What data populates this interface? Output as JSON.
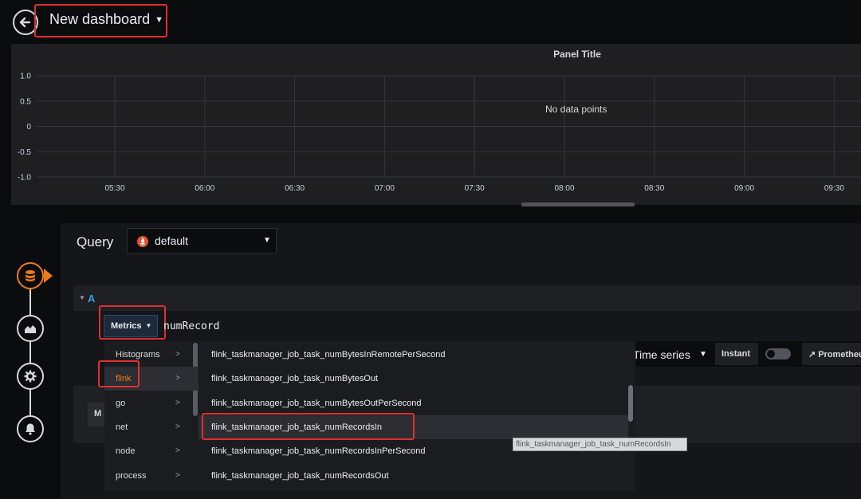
{
  "header": {
    "title": "New dashboard"
  },
  "panel": {
    "title": "Panel Title",
    "no_data": "No data points",
    "y_ticks": [
      "1.0",
      "0.5",
      "0",
      "-0.5",
      "-1.0"
    ],
    "x_ticks": [
      "05:30",
      "06:00",
      "06:30",
      "07:00",
      "07:30",
      "08:00",
      "08:30",
      "09:00",
      "09:30"
    ]
  },
  "query": {
    "label": "Query",
    "datasource": "default",
    "row_label": "A",
    "metrics_label": "Metrics",
    "input_value": "numRecord",
    "format": "Time series",
    "instant_label": "Instant",
    "prometheus_label": "Prometheu",
    "lower_box_label": "M"
  },
  "menu": {
    "categories": [
      {
        "label": "Histograms",
        "arrow": ">"
      },
      {
        "label": "flink",
        "arrow": ">"
      },
      {
        "label": "go",
        "arrow": ">"
      },
      {
        "label": "net",
        "arrow": ">"
      },
      {
        "label": "node",
        "arrow": ">"
      },
      {
        "label": "process",
        "arrow": ">"
      }
    ],
    "items": [
      "flink_taskmanager_job_task_numBytesInRemotePerSecond",
      "flink_taskmanager_job_task_numBytesOut",
      "flink_taskmanager_job_task_numBytesOutPerSecond",
      "flink_taskmanager_job_task_numRecordsIn",
      "flink_taskmanager_job_task_numRecordsInPerSecond",
      "flink_taskmanager_job_task_numRecordsOut"
    ],
    "tooltip": "flink_taskmanager_job_task_numRecordsIn"
  },
  "nav": {
    "icons": [
      "database-icon",
      "chart-area-icon",
      "gear-icon",
      "bell-icon"
    ]
  },
  "colors": {
    "accent": "#eb7b18",
    "highlight": "#e02f2f",
    "link": "#33a2e5"
  }
}
